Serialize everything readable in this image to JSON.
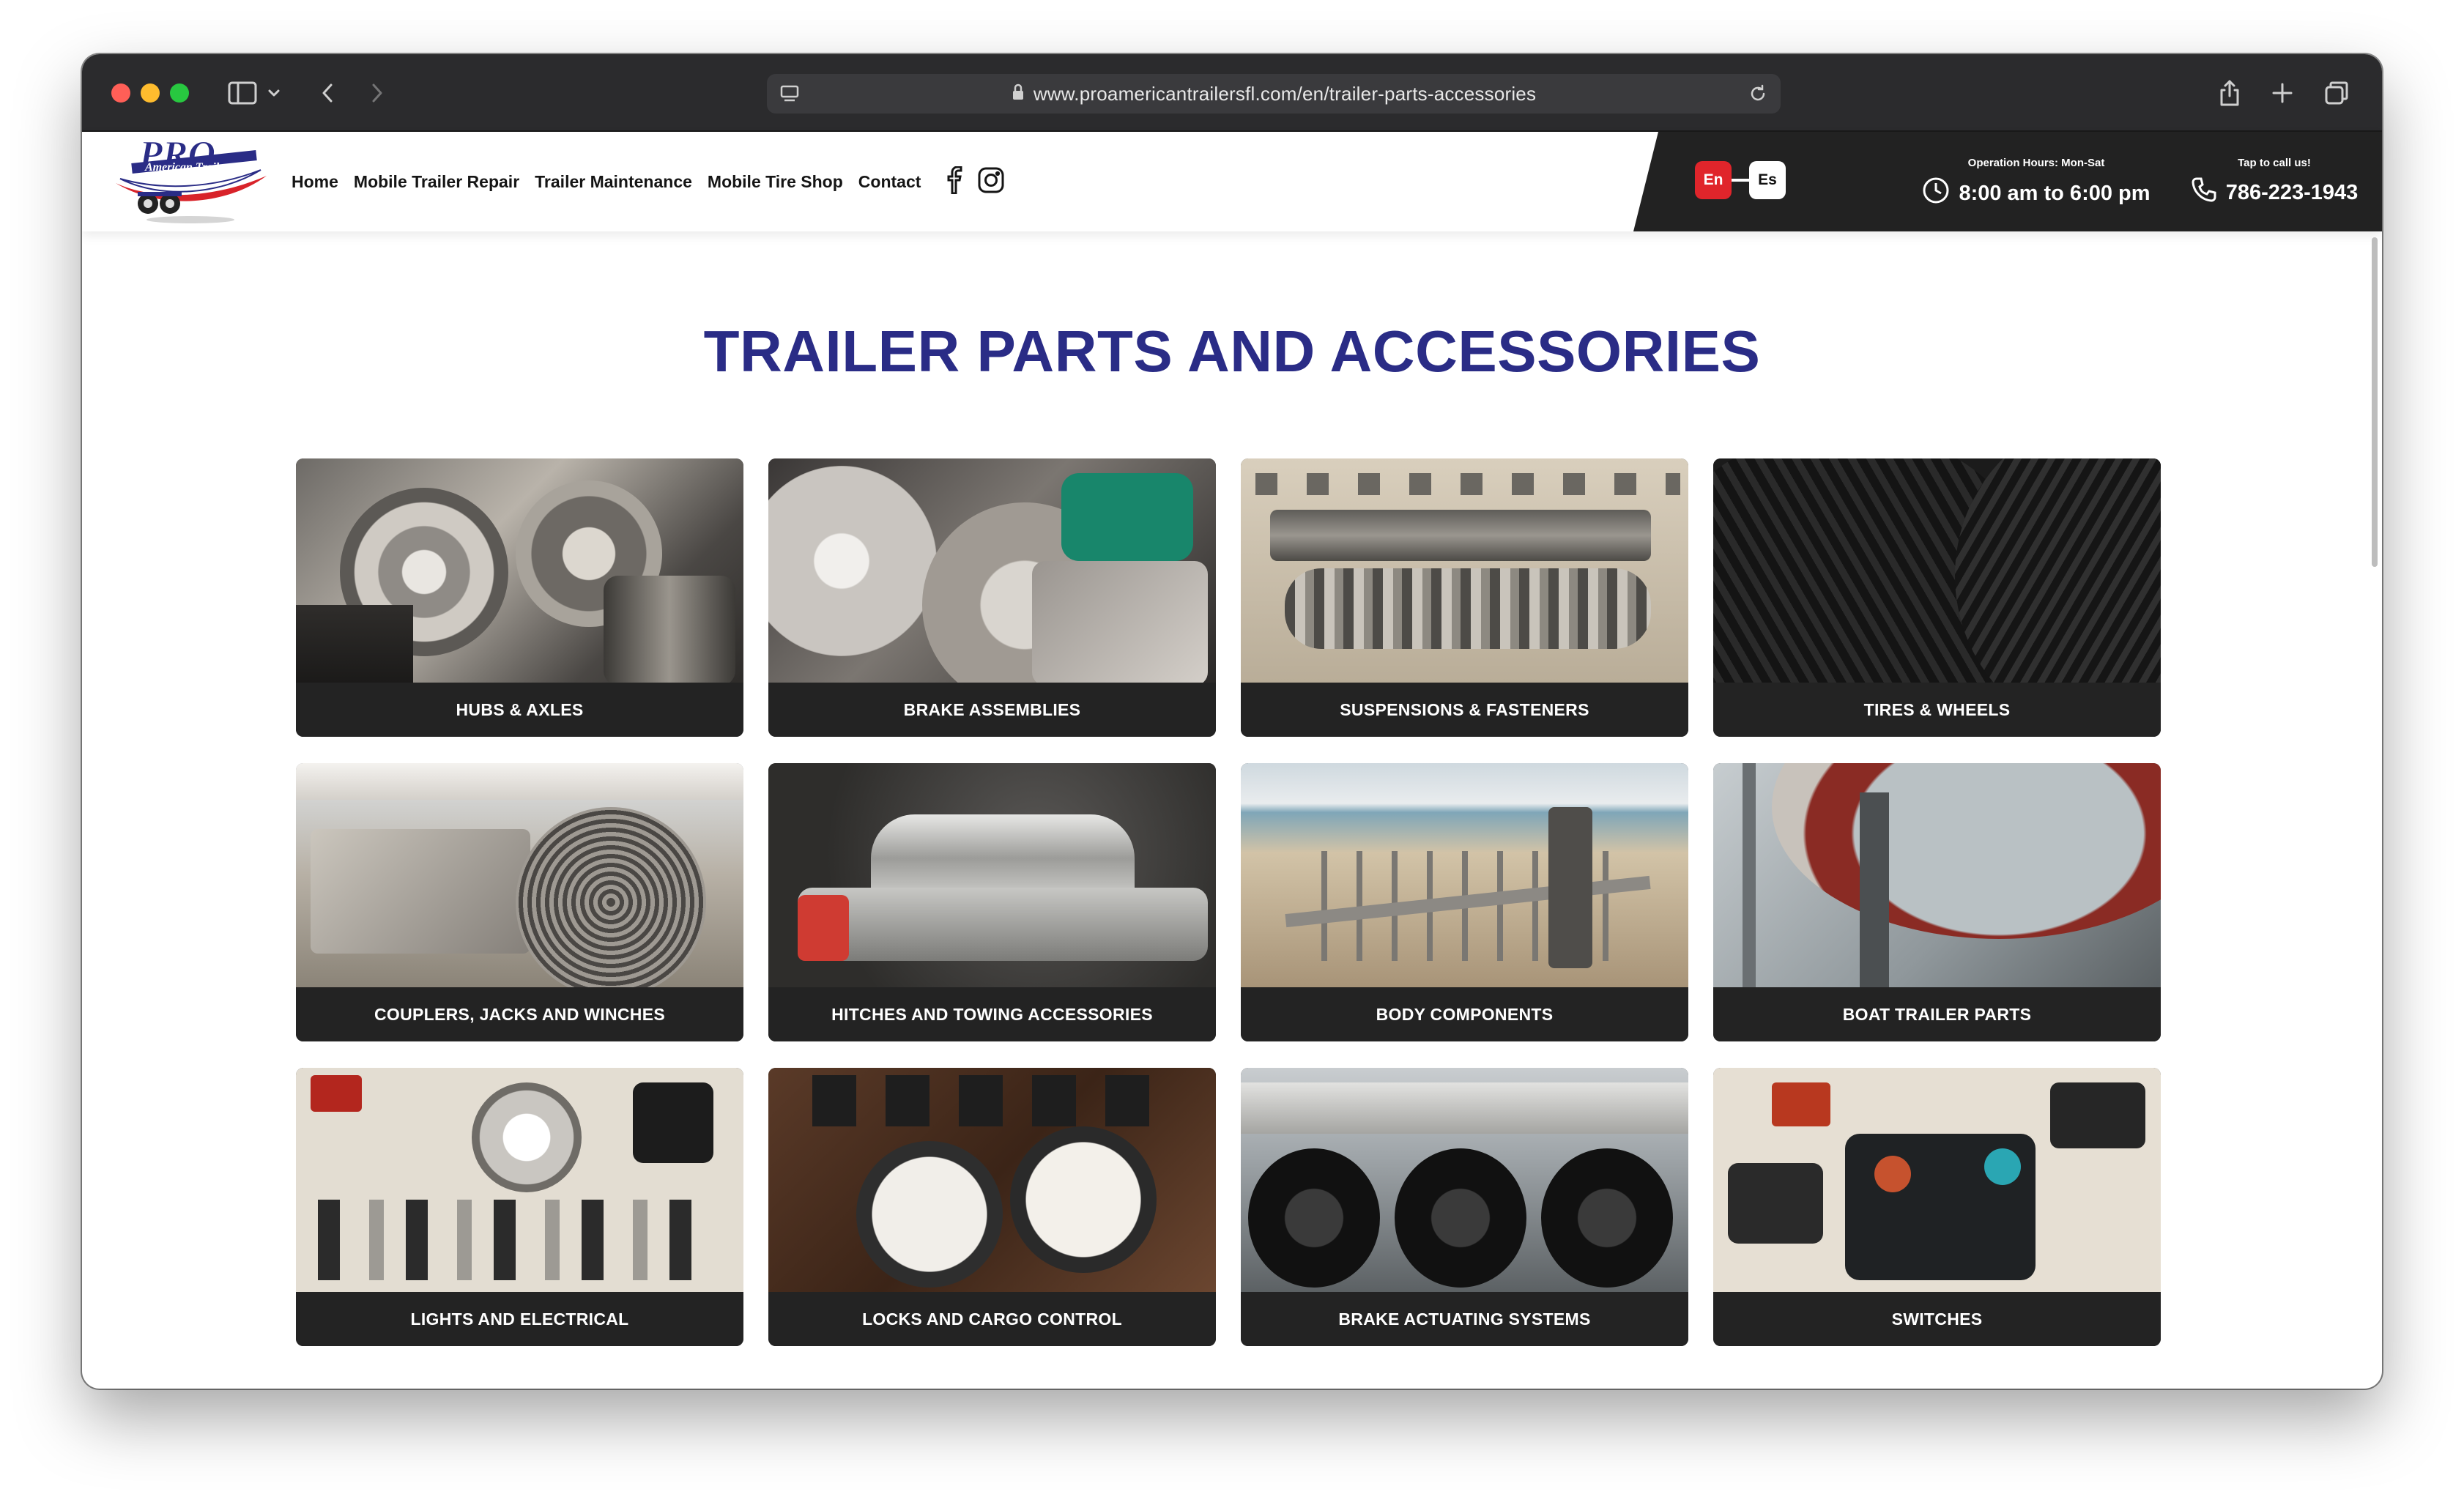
{
  "browser": {
    "url": "www.proamericantrailersfl.com/en/trailer-parts-accessories"
  },
  "header": {
    "logo_text": "PRO American Trailers",
    "nav": [
      {
        "label": "Home"
      },
      {
        "label": "Mobile Trailer Repair"
      },
      {
        "label": "Trailer Maintenance"
      },
      {
        "label": "Mobile Tire Shop"
      },
      {
        "label": "Contact"
      }
    ],
    "lang": {
      "en": "En",
      "es": "Es"
    },
    "hours_label": "Operation Hours: Mon-Sat",
    "hours_value": "8:00 am to 6:00 pm",
    "phone_label": "Tap to call us!",
    "phone_value": "786-223-1943"
  },
  "main": {
    "title": "TRAILER PARTS AND ACCESSORIES",
    "categories": [
      {
        "label": "HUBS & AXLES"
      },
      {
        "label": "BRAKE ASSEMBLIES"
      },
      {
        "label": "SUSPENSIONS & FASTENERS"
      },
      {
        "label": "TIRES & WHEELS"
      },
      {
        "label": "COUPLERS, JACKS AND WINCHES"
      },
      {
        "label": "HITCHES AND TOWING ACCESSORIES"
      },
      {
        "label": "BODY COMPONENTS"
      },
      {
        "label": "BOAT TRAILER PARTS"
      },
      {
        "label": "LIGHTS AND ELECTRICAL"
      },
      {
        "label": "LOCKS AND CARGO CONTROL"
      },
      {
        "label": "BRAKE ACTUATING SYSTEMS"
      },
      {
        "label": "SWITCHES"
      }
    ]
  },
  "colors": {
    "title_blue": "#2a2c86",
    "accent_red": "#e0252b",
    "dark": "#222222"
  }
}
